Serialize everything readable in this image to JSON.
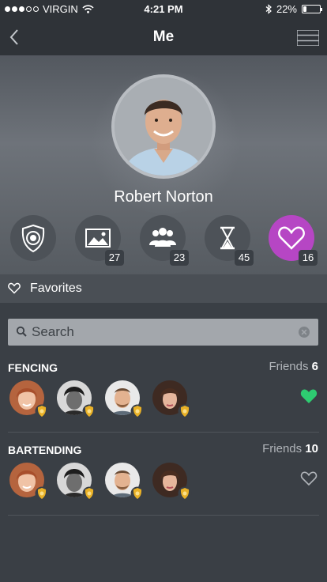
{
  "status_bar": {
    "carrier": "VIRGIN",
    "time": "4:21 PM",
    "battery": "22%",
    "battery_level": 0.22
  },
  "nav": {
    "title": "Me",
    "back_icon": "chevron-left-icon",
    "menu_icon": "hamburger-menu-icon"
  },
  "profile": {
    "name": "Robert Norton"
  },
  "stats": [
    {
      "icon": "badge-icon",
      "count": ""
    },
    {
      "icon": "image-icon",
      "count": "27"
    },
    {
      "icon": "people-icon",
      "count": "23"
    },
    {
      "icon": "hourglass-icon",
      "count": "45"
    },
    {
      "icon": "heart-icon",
      "count": "16",
      "active": true
    }
  ],
  "favorites": {
    "label": "Favorites"
  },
  "search": {
    "placeholder": "Search",
    "value": ""
  },
  "groups": [
    {
      "title": "FENCING",
      "friends_label": "Friends",
      "friends_count": "6",
      "favorited": true
    },
    {
      "title": "BARTENDING",
      "friends_label": "Friends",
      "friends_count": "10",
      "favorited": false
    }
  ],
  "colors": {
    "accent_purple": "#b646c4",
    "favorite_green": "#2ecc71",
    "badge_gold": "#e9b127",
    "background": "#3a3f45"
  }
}
